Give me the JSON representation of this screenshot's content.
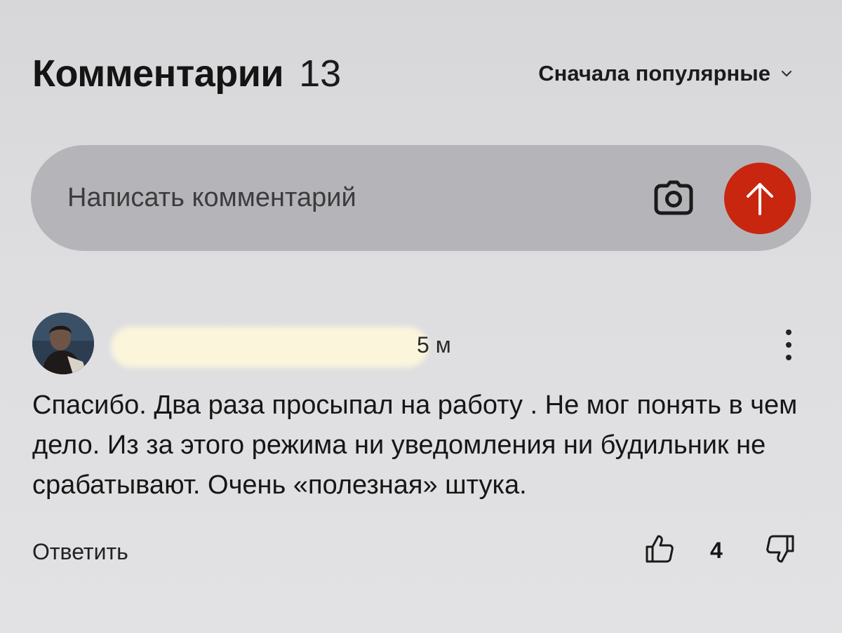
{
  "header": {
    "title": "Комментарии",
    "count": "13",
    "sort_label": "Сначала популярные"
  },
  "composer": {
    "placeholder": "Написать комментарий"
  },
  "comment": {
    "time": "5 м",
    "text": "Спасибо. Два раза просыпал на работу . Не мог понять в чем дело. Из за этого режима ни уведомления ни будильник не срабатывают. Очень «полезная» штука.",
    "reply_label": "Ответить",
    "votes": "4"
  },
  "colors": {
    "send_button": "#c8260f",
    "composer_bg": "#b5b5b9",
    "page_bg": "#dcdcde"
  },
  "icons": {
    "sort": "chevron-down-icon",
    "camera": "camera-icon",
    "send": "arrow-up-icon",
    "more": "more-vertical-icon",
    "like": "thumbs-up-icon",
    "dislike": "thumbs-down-icon"
  }
}
